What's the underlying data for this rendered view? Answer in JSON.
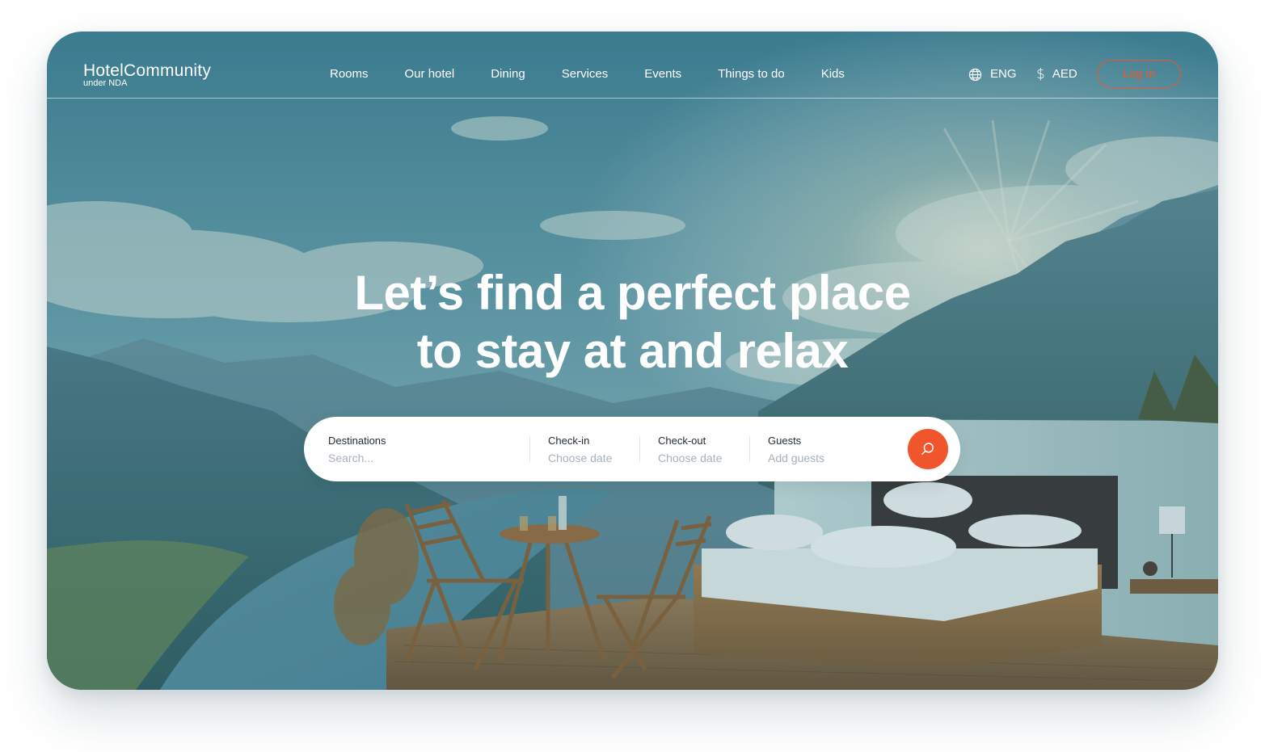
{
  "brand": {
    "name": "HotelCommunity",
    "tagline": "under NDA"
  },
  "nav": {
    "items": [
      {
        "label": "Rooms"
      },
      {
        "label": "Our hotel"
      },
      {
        "label": "Dining"
      },
      {
        "label": "Services"
      },
      {
        "label": "Events"
      },
      {
        "label": "Things to do"
      },
      {
        "label": "Kids"
      }
    ]
  },
  "header": {
    "language": "ENG",
    "currency": "AED",
    "login_label": "Log in",
    "language_icon": "globe-icon",
    "currency_icon": "dollar-icon"
  },
  "hero": {
    "headline_line1": "Let’s find a perfect place",
    "headline_line2": "to stay at and relax"
  },
  "search": {
    "destinations_label": "Destinations",
    "destinations_placeholder": "Search...",
    "checkin_label": "Check-in",
    "checkin_value": "Choose date",
    "checkout_label": "Check-out",
    "checkout_value": "Choose date",
    "guests_label": "Guests",
    "guests_value": "Add guests",
    "search_icon": "search-icon"
  },
  "colors": {
    "accent": "#f0552b",
    "text_dark": "#1f2a36",
    "placeholder": "#a7b1ba"
  }
}
